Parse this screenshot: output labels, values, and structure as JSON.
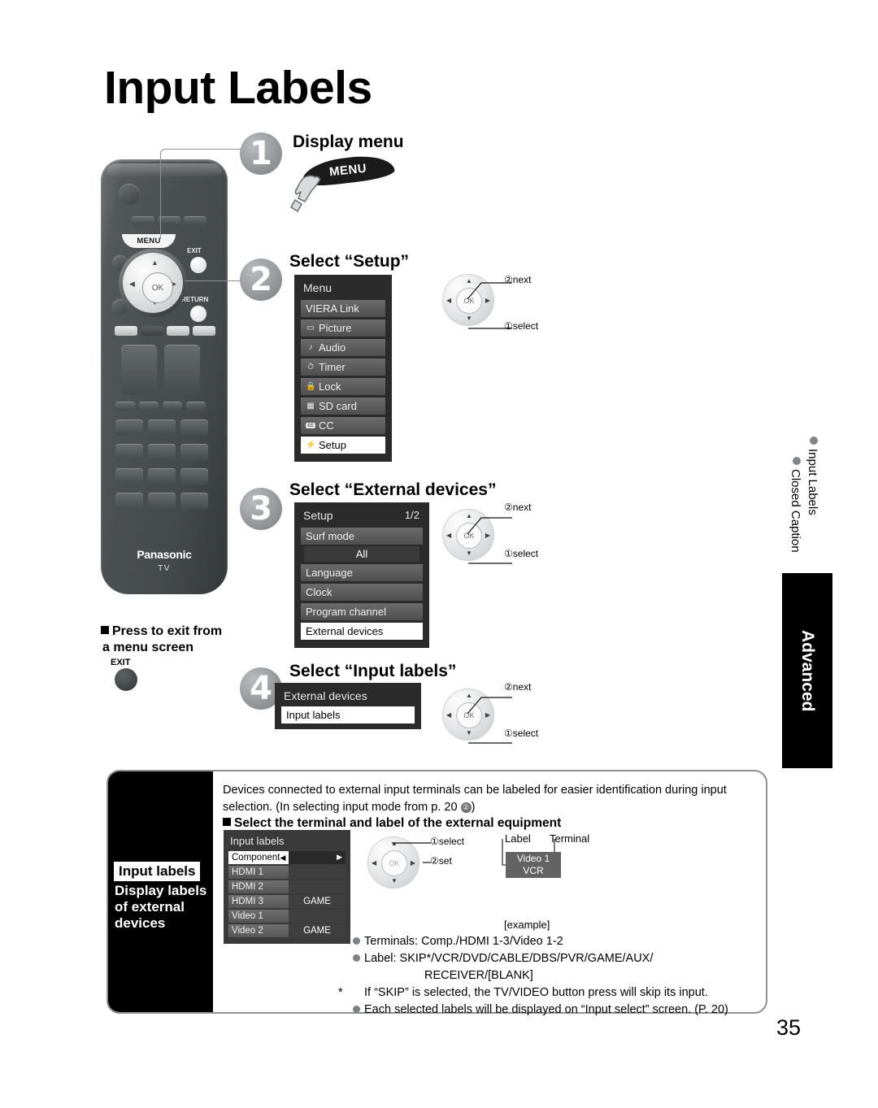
{
  "page": {
    "title": "Input Labels",
    "number": "35"
  },
  "remote": {
    "menu_button": "MENU",
    "exit_button": "EXIT",
    "return_button": "RETURN",
    "ok_button": "OK",
    "brand": "Panasonic",
    "brand_sub": "TV"
  },
  "steps": [
    {
      "num": "1",
      "heading": "Display menu",
      "banner": "MENU"
    },
    {
      "num": "2",
      "heading": "Select “Setup”",
      "osd": {
        "title": "Menu",
        "rows": [
          {
            "icon": "",
            "label": "VIERA Link",
            "selected": false
          },
          {
            "icon": "▭",
            "label": "Picture",
            "selected": false
          },
          {
            "icon": "♪",
            "label": "Audio",
            "selected": false
          },
          {
            "icon": "⏱",
            "label": "Timer",
            "selected": false
          },
          {
            "icon": "ὑ2",
            "label": "Lock",
            "selected": false
          },
          {
            "icon": "▤",
            "label": "SD card",
            "selected": false
          },
          {
            "icon": "cc",
            "label": "CC",
            "selected": false
          },
          {
            "icon": "⚡",
            "label": "Setup",
            "selected": true
          }
        ]
      },
      "dial": {
        "ok": "OK",
        "note_next": "next",
        "note_select": "select",
        "num_next": "②",
        "num_select": "①"
      }
    },
    {
      "num": "3",
      "heading": "Select “External devices”",
      "osd": {
        "title": "Setup",
        "page": "1/2",
        "rows": [
          {
            "label": "Surf mode",
            "selected": false
          },
          {
            "label": "All",
            "sub": true
          },
          {
            "label": "Language",
            "selected": false
          },
          {
            "label": "Clock",
            "selected": false
          },
          {
            "label": "Program channel",
            "selected": false
          },
          {
            "label": "External devices",
            "selected": true
          }
        ]
      },
      "dial": {
        "ok": "OK",
        "note_next": "next",
        "note_select": "select",
        "num_next": "②",
        "num_select": "①"
      }
    },
    {
      "num": "4",
      "heading": "Select “Input labels”",
      "osd": {
        "title": "External devices",
        "rows": [
          {
            "label": "Input labels",
            "selected": true
          }
        ]
      },
      "dial": {
        "ok": "OK",
        "note_next": "next",
        "note_select": "select",
        "num_next": "②",
        "num_select": "①"
      }
    }
  ],
  "exit_note": {
    "line1": "Press to exit from",
    "line2": "a menu screen",
    "button_label": "EXIT"
  },
  "side_tab": {
    "advanced": "Advanced",
    "toc": [
      "Input Labels",
      "Closed Caption"
    ]
  },
  "feature_panel": {
    "badge": "Input labels",
    "black_text": "Display labels of external devices",
    "paragraph": "Devices connected to external input terminals can be labeled for easier identification during input selection. (In selecting input mode from p. 20 ",
    "paragraph_tail": ")",
    "paragraph_circle": "②",
    "subheading": "Select the terminal and label of the external equipment",
    "osd": {
      "title": "Input labels",
      "rows": [
        {
          "terminal": "Component",
          "value": "",
          "selected": true
        },
        {
          "terminal": "HDMI 1",
          "value": "",
          "selected": false
        },
        {
          "terminal": "HDMI 2",
          "value": "",
          "selected": false
        },
        {
          "terminal": "HDMI 3",
          "value": "GAME",
          "selected": false
        },
        {
          "terminal": "Video 1",
          "value": "",
          "selected": false
        },
        {
          "terminal": "Video 2",
          "value": "GAME",
          "selected": false
        }
      ]
    },
    "dial": {
      "ok": "OK",
      "note_select": "select",
      "note_set": "set",
      "num_select": "①",
      "num_set": "②"
    },
    "example": {
      "label_caption": "Label",
      "terminal_caption": "Terminal",
      "terminal_value": "Video 1",
      "label_value": "VCR",
      "caption": "[example]"
    },
    "bullets": {
      "terminals": "Terminals:  Comp./HDMI 1-3/Video 1-2",
      "label_line1": "Label:  SKIP*/VCR/DVD/CABLE/DBS/PVR/GAME/AUX/",
      "label_line2": "RECEIVER/[BLANK]",
      "footnote": "If “SKIP” is selected, the TV/VIDEO button press will skip its input.",
      "footnote_marker": "*",
      "last": "Each selected labels will be displayed on “Input select” screen. (P. 20)"
    }
  },
  "colors": {
    "accent_black": "#000000",
    "osd_bg": "#2b2b2b",
    "osd_row": "#5f5f5f",
    "step_circle": "#8d9194"
  }
}
